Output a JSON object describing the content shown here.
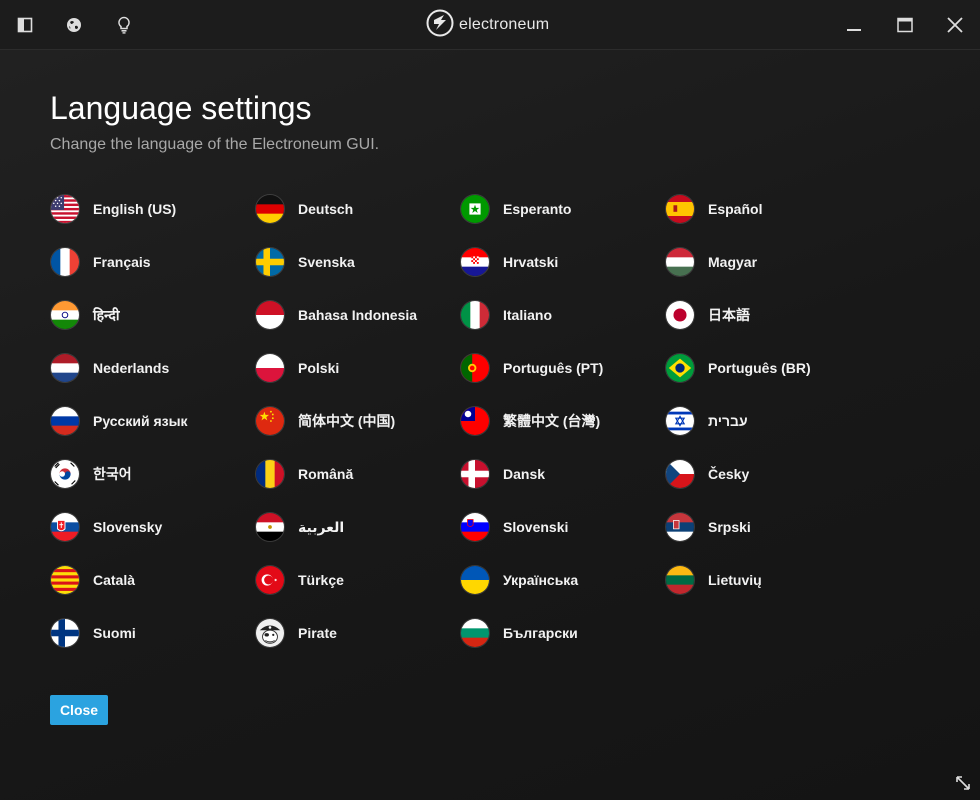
{
  "titlebar": {
    "brand": "electroneum",
    "left_icons": [
      "sidebar-toggle-icon",
      "globe-icon",
      "lightbulb-icon"
    ],
    "window_controls": [
      "minimize-icon",
      "maximize-icon",
      "close-icon"
    ]
  },
  "page": {
    "title": "Language settings",
    "subtitle": "Change the language of the Electroneum GUI."
  },
  "languages": [
    {
      "label": "English (US)",
      "flag": "us"
    },
    {
      "label": "Deutsch",
      "flag": "de"
    },
    {
      "label": "Esperanto",
      "flag": "eo"
    },
    {
      "label": "Español",
      "flag": "es"
    },
    {
      "label": "Français",
      "flag": "fr"
    },
    {
      "label": "Svenska",
      "flag": "se"
    },
    {
      "label": "Hrvatski",
      "flag": "hr"
    },
    {
      "label": "Magyar",
      "flag": "hu"
    },
    {
      "label": "हिन्दी",
      "flag": "in"
    },
    {
      "label": "Bahasa Indonesia",
      "flag": "id"
    },
    {
      "label": "Italiano",
      "flag": "it"
    },
    {
      "label": "日本語",
      "flag": "jp"
    },
    {
      "label": "Nederlands",
      "flag": "nl"
    },
    {
      "label": "Polski",
      "flag": "pl"
    },
    {
      "label": "Português (PT)",
      "flag": "pt"
    },
    {
      "label": "Português (BR)",
      "flag": "br"
    },
    {
      "label": "Русский язык",
      "flag": "ru"
    },
    {
      "label": "简体中文 (中国)",
      "flag": "cn"
    },
    {
      "label": "繁體中文 (台灣)",
      "flag": "tw"
    },
    {
      "label": "עברית",
      "flag": "il"
    },
    {
      "label": "한국어",
      "flag": "kr"
    },
    {
      "label": "Română",
      "flag": "ro"
    },
    {
      "label": "Dansk",
      "flag": "dk"
    },
    {
      "label": "Česky",
      "flag": "cz"
    },
    {
      "label": "Slovensky",
      "flag": "sk"
    },
    {
      "label": "العربية",
      "flag": "eg"
    },
    {
      "label": "Slovenski",
      "flag": "si"
    },
    {
      "label": "Srpski",
      "flag": "rs"
    },
    {
      "label": "Català",
      "flag": "cat"
    },
    {
      "label": "Türkçe",
      "flag": "tr"
    },
    {
      "label": "Українська",
      "flag": "ua"
    },
    {
      "label": "Lietuvių",
      "flag": "lt"
    },
    {
      "label": "Suomi",
      "flag": "fi"
    },
    {
      "label": "Pirate",
      "flag": "pirate"
    },
    {
      "label": "Български",
      "flag": "bg"
    }
  ],
  "actions": {
    "close_label": "Close",
    "accent_color": "#2ba3e0"
  }
}
